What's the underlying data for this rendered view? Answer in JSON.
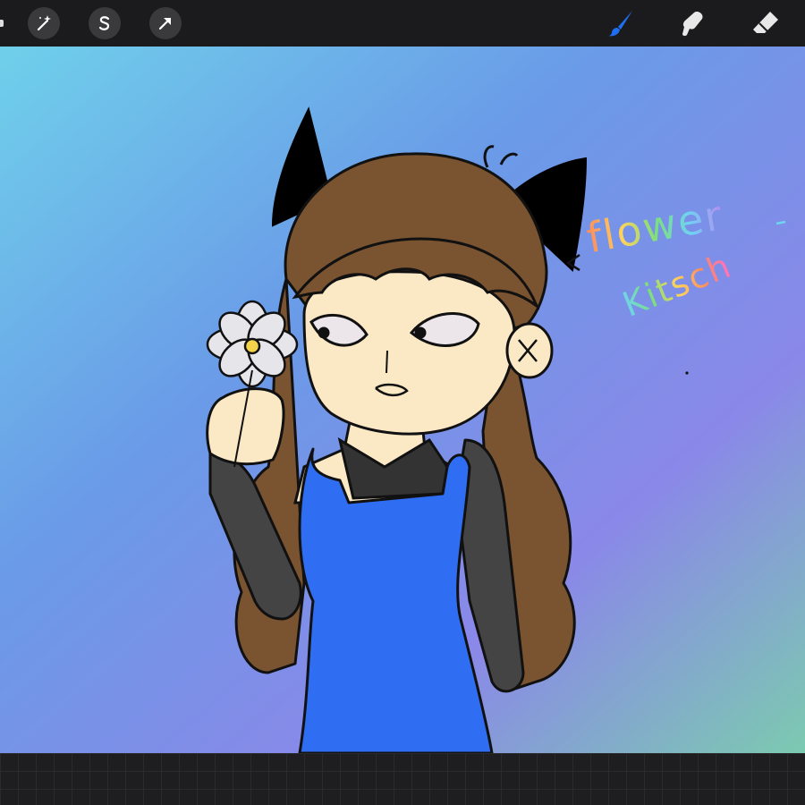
{
  "toolbar_left": [
    {
      "name": "adjustments-wand-icon"
    },
    {
      "name": "selection-s-icon"
    },
    {
      "name": "transform-arrow-icon"
    }
  ],
  "toolbar_right": [
    {
      "name": "brush-icon",
      "active": true,
      "color": "#1e6ff0"
    },
    {
      "name": "smudge-icon",
      "active": false
    },
    {
      "name": "eraser-icon",
      "active": false
    }
  ],
  "canvas": {
    "background_colors": [
      "#6fd0ea",
      "#6a9ae8",
      "#8a88e8",
      "#7ccab0"
    ],
    "handwritten_text": {
      "line1": "flower",
      "line2": "Kitsch",
      "arrow": "<"
    }
  },
  "colors": {
    "accent": "#1e6ff0",
    "dress": "#2f6df2",
    "hair": "#7a5330",
    "skin": "#fbe9c6"
  }
}
